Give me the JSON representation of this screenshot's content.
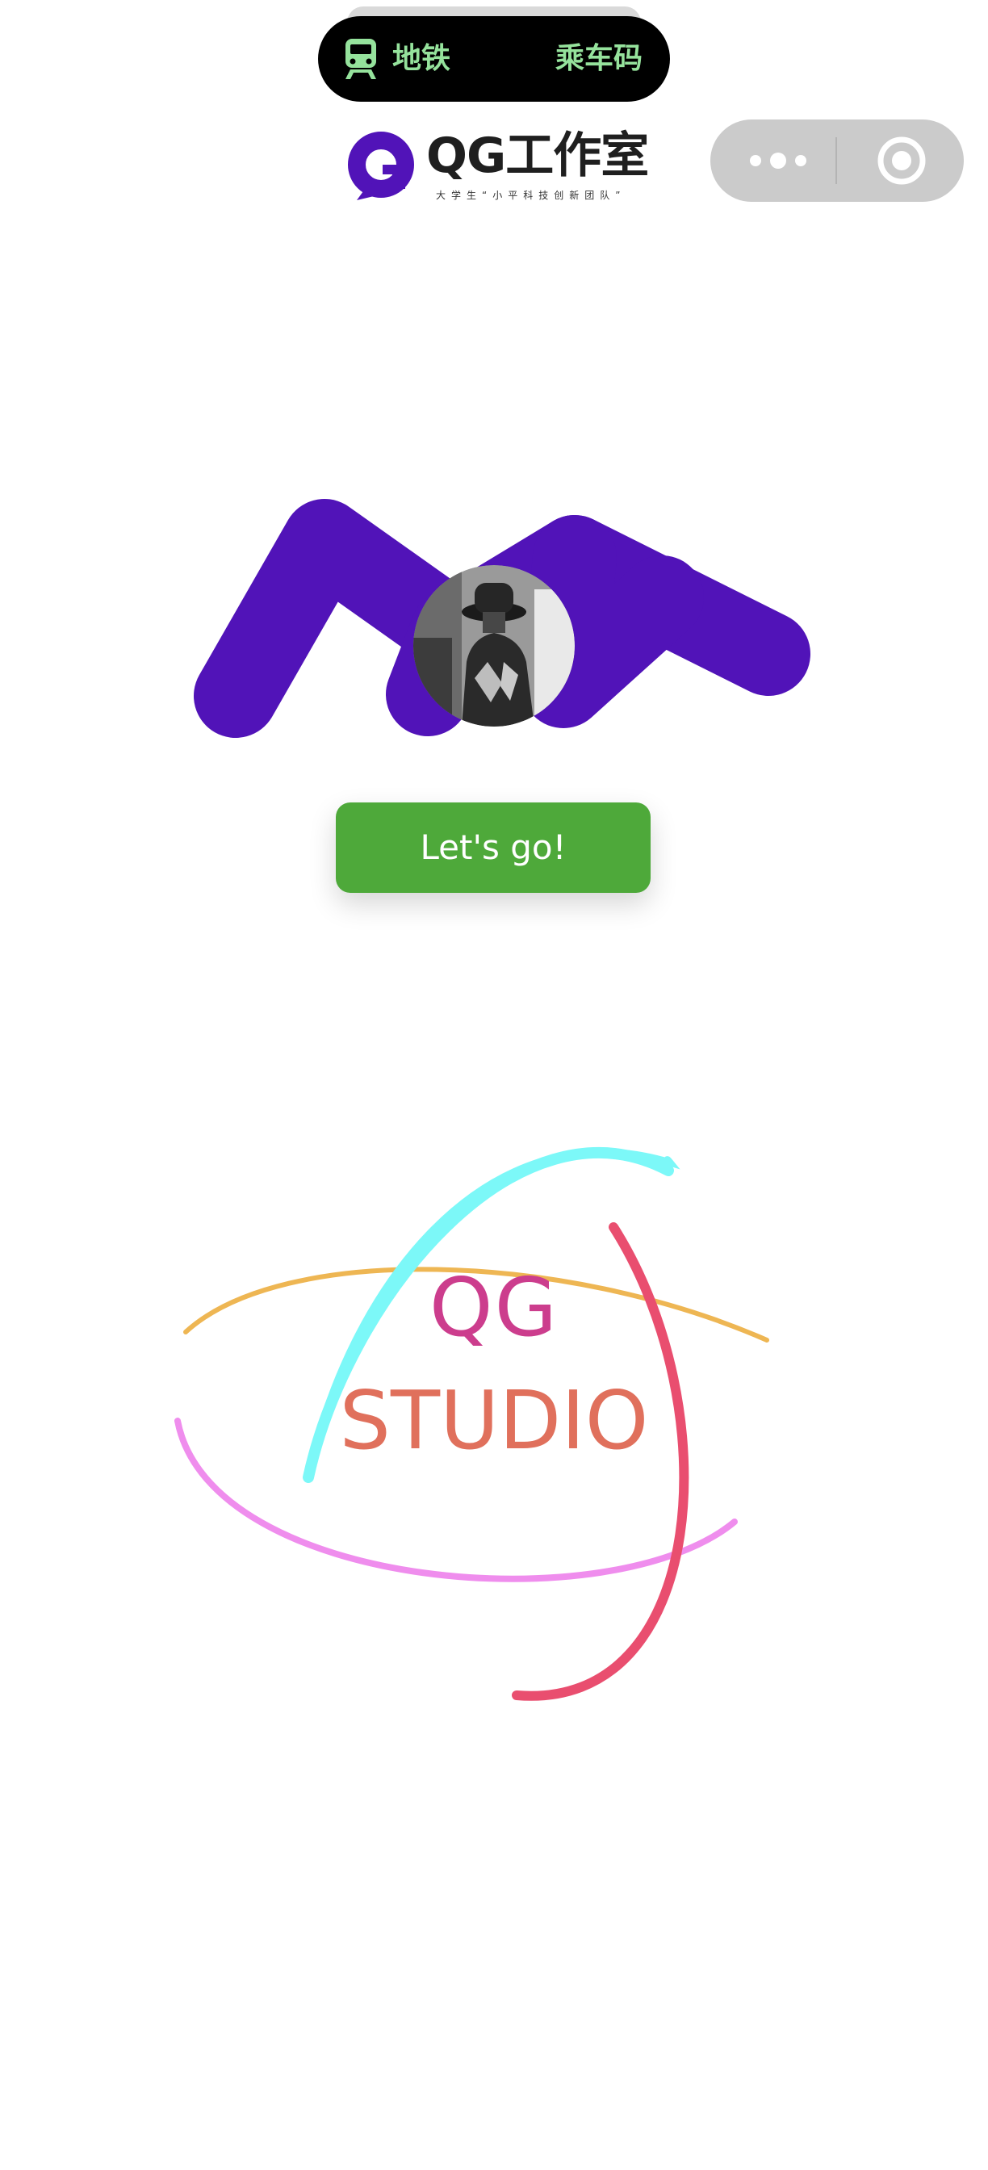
{
  "status_pill": {
    "left_label": "地铁",
    "right_label": "乘车码",
    "icon": "metro-train-icon",
    "text_color": "#95e29c"
  },
  "capsule": {
    "more_icon": "more-dots-icon",
    "close_icon": "close-target-icon"
  },
  "header": {
    "logo_name": "QG工作室",
    "slogan": "大学生“小平科技创新团队”",
    "brand_color": "#5113b8"
  },
  "hero": {
    "shape_color": "#5113b8",
    "avatar": "user-avatar-photo"
  },
  "cta": {
    "label": "Let's go!",
    "color": "#4ea93a"
  },
  "emblem": {
    "line1": "QG",
    "line2": "STUDIO",
    "ring_colors": [
      "#7cf8f8",
      "#eeb653",
      "#ef8ded",
      "#e94e6f"
    ]
  }
}
